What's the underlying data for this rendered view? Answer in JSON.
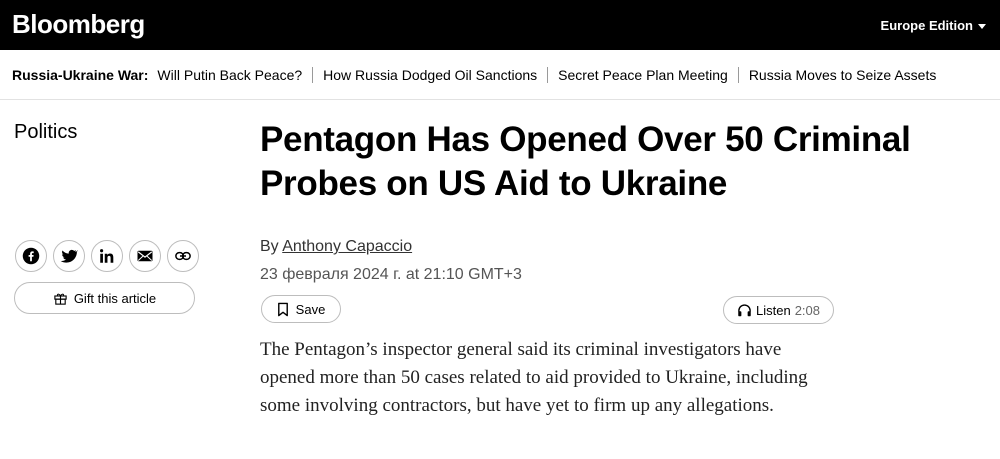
{
  "header": {
    "logo": "Bloomberg",
    "edition": "Europe Edition",
    "colors": {
      "background": "#000000",
      "text": "#ffffff"
    }
  },
  "storyline": {
    "label": "Russia-Ukraine War:",
    "links": [
      "Will Putin Back Peace?",
      "How Russia Dodged Oil Sanctions",
      "Secret Peace Plan Meeting",
      "Russia Moves to Seize Assets"
    ]
  },
  "article": {
    "section": "Politics",
    "headline": "Pentagon Has Opened Over 50 Criminal Probes on US Aid to Ukraine",
    "byline_prefix": "By ",
    "author": "Anthony Capaccio",
    "date": "23 февраля 2024 г. at 21:10 GMT+3",
    "abstract": "The Pentagon’s inspector general said its criminal investigators have opened more than 50 cases related to aid provided to Ukraine, including some involving contractors, but have yet to firm up any allegations."
  },
  "share": {
    "icons": [
      "facebook-icon",
      "twitter-icon",
      "linkedin-icon",
      "email-icon",
      "link-icon"
    ],
    "gift_label": "Gift this article"
  },
  "actions": {
    "save_label": "Save",
    "listen_label": "Listen",
    "listen_duration": "2:08"
  }
}
